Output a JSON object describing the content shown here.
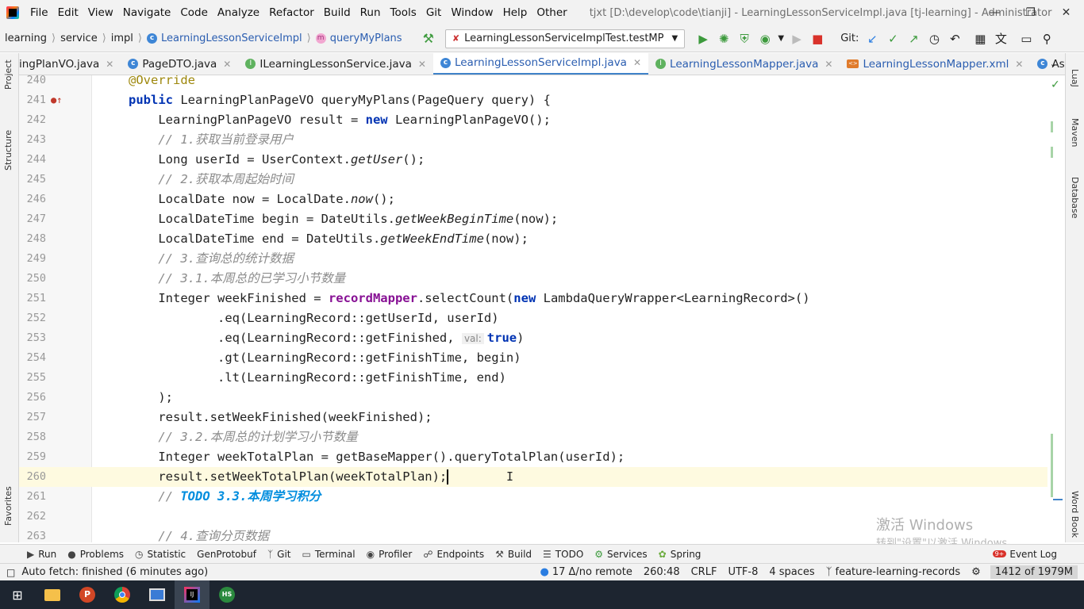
{
  "menu": [
    "File",
    "Edit",
    "View",
    "Navigate",
    "Code",
    "Analyze",
    "Refactor",
    "Build",
    "Run",
    "Tools",
    "Git",
    "Window",
    "Help",
    "Other"
  ],
  "window_title": "tjxt [D:\\develop\\code\\tianji] - LearningLessonServiceImpl.java [tj-learning] - Administrator",
  "breadcrumb": {
    "module": "learning",
    "p1": "service",
    "p2": "impl",
    "cls": "LearningLessonServiceImpl",
    "method": "queryMyPlans"
  },
  "run_config": "LearningLessonServiceImplTest.testMP",
  "git_label": "Git:",
  "tabs": [
    {
      "name": "ingPlanVO.java",
      "icon": "C"
    },
    {
      "name": "PageDTO.java",
      "icon": "C"
    },
    {
      "name": "ILearningLessonService.java",
      "icon": "I"
    },
    {
      "name": "LearningLessonServiceImpl.java",
      "icon": "C"
    },
    {
      "name": "LearningLessonMapper.java",
      "icon": "I"
    },
    {
      "name": "LearningLessonMapper.xml",
      "icon": "X"
    },
    {
      "name": "AssertUtils.java",
      "icon": "C"
    }
  ],
  "left_tools": [
    "Project",
    "Structure",
    "Favorites"
  ],
  "right_tools": [
    "LuaJ",
    "Maven",
    "Database",
    "Word Book"
  ],
  "lines": [
    "240",
    "241",
    "242",
    "243",
    "244",
    "245",
    "246",
    "247",
    "248",
    "249",
    "250",
    "251",
    "252",
    "253",
    "254",
    "255",
    "256",
    "257",
    "258",
    "259",
    "260",
    "261",
    "262",
    "263"
  ],
  "code": {
    "l240": "@Override",
    "l241a": "public",
    "l241b": " LearningPlanPageVO queryMyPlans(PageQuery query) {",
    "l242a": "    LearningPlanPageVO result = ",
    "l242b": "new",
    "l242c": " LearningPlanPageVO();",
    "l243": "    // 1.获取当前登录用户",
    "l244a": "    Long userId = UserContext.",
    "l244b": "getUser",
    "l244c": "();",
    "l245": "    // 2.获取本周起始时间",
    "l246a": "    LocalDate now = LocalDate.",
    "l246b": "now",
    "l246c": "();",
    "l247a": "    LocalDateTime begin = DateUtils.",
    "l247b": "getWeekBeginTime",
    "l247c": "(now);",
    "l248a": "    LocalDateTime end = DateUtils.",
    "l248b": "getWeekEndTime",
    "l248c": "(now);",
    "l249": "    // 3.查询总的统计数据",
    "l250": "    // 3.1.本周总的已学习小节数量",
    "l251a": "    Integer weekFinished = ",
    "l251b": "recordMapper",
    "l251c": ".selectCount(",
    "l251d": "new",
    "l251e": " LambdaQueryWrapper<LearningRecord>()",
    "l252": "            .eq(LearningRecord::getUserId, userId)",
    "l253a": "            .eq(LearningRecord::getFinished, ",
    "l253hint": "val:",
    "l253b": "true",
    "l253c": ")",
    "l254": "            .gt(LearningRecord::getFinishTime, begin)",
    "l255": "            .lt(LearningRecord::getFinishTime, end)",
    "l256": "    );",
    "l257": "    result.setWeekFinished(weekFinished);",
    "l258": "    // 3.2.本周总的计划学习小节数量",
    "l259": "    Integer weekTotalPlan = getBaseMapper().queryTotalPlan(userId);",
    "l260": "    result.setWeekTotalPlan(weekTotalPlan);",
    "l261a": "    // ",
    "l261b": "TODO 3.3.本周学习积分",
    "l263": "    // 4.查询分页数据"
  },
  "tool_windows": [
    "Run",
    "Problems",
    "Statistic",
    "GenProtobuf",
    "Git",
    "Terminal",
    "Profiler",
    "Endpoints",
    "Build",
    "TODO",
    "Services",
    "Spring",
    "Event Log"
  ],
  "event_badge": "9+",
  "status": {
    "message": "Auto fetch: finished (6 minutes ago)",
    "git_sync": "17 Δ/no remote",
    "position": "260:48",
    "line_sep": "CRLF",
    "encoding": "UTF-8",
    "indent": "4 spaces",
    "branch": "feature-learning-records",
    "memory": "1412 of 1979M"
  },
  "watermark": {
    "line1": "激活 Windows",
    "line2": "转到\"设置\"以激活 Windows。"
  },
  "taskbar_hs": "HS",
  "colors": {
    "keyword": "#0033b3",
    "comment": "#8c8c8c",
    "annotation": "#9e880d",
    "field": "#871094",
    "todo": "#008dde",
    "accent": "#4083c9"
  }
}
